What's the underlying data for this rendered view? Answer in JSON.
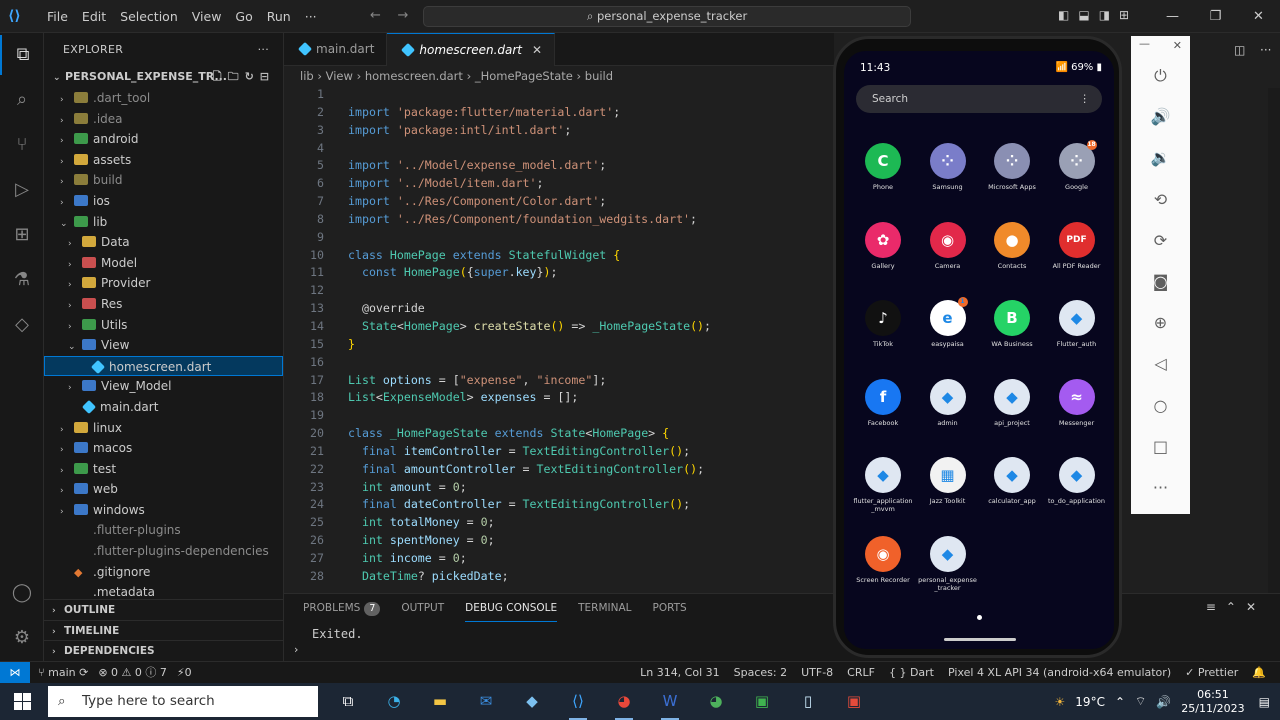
{
  "window": {
    "menu": [
      "File",
      "Edit",
      "Selection",
      "View",
      "Go",
      "Run",
      "···"
    ],
    "command_center": "personal_expense_tracker",
    "controls": [
      "—",
      "❐",
      "✕"
    ]
  },
  "activity_bar": [
    "explorer-icon",
    "search-icon",
    "source-control-icon",
    "run-debug-icon",
    "extensions-icon",
    "testing-icon",
    "flutter-icon",
    "account-icon",
    "settings-gear-icon"
  ],
  "explorer": {
    "title": "EXPLORER",
    "project": "PERSONAL_EXPENSE_TR...",
    "items": [
      {
        "label": ".dart_tool",
        "indent": 1,
        "kind": "folder",
        "dim": true
      },
      {
        "label": ".idea",
        "indent": 1,
        "kind": "folder",
        "dim": true
      },
      {
        "label": "android",
        "indent": 1,
        "kind": "folder-green"
      },
      {
        "label": "assets",
        "indent": 1,
        "kind": "folder-yellow"
      },
      {
        "label": "build",
        "indent": 1,
        "kind": "folder",
        "dim": true
      },
      {
        "label": "ios",
        "indent": 1,
        "kind": "folder-blue"
      },
      {
        "label": "lib",
        "indent": 1,
        "kind": "folder-green",
        "open": true
      },
      {
        "label": "Data",
        "indent": 2,
        "kind": "folder-yellow"
      },
      {
        "label": "Model",
        "indent": 2,
        "kind": "folder-red"
      },
      {
        "label": "Provider",
        "indent": 2,
        "kind": "folder-yellow"
      },
      {
        "label": "Res",
        "indent": 2,
        "kind": "folder-red"
      },
      {
        "label": "Utils",
        "indent": 2,
        "kind": "folder-green"
      },
      {
        "label": "View",
        "indent": 2,
        "kind": "folder-blue",
        "open": true
      },
      {
        "label": "homescreen.dart",
        "indent": 3,
        "kind": "dart",
        "selected": true
      },
      {
        "label": "View_Model",
        "indent": 2,
        "kind": "folder-blue"
      },
      {
        "label": "main.dart",
        "indent": 2,
        "kind": "dart"
      },
      {
        "label": "linux",
        "indent": 1,
        "kind": "folder-yellow"
      },
      {
        "label": "macos",
        "indent": 1,
        "kind": "folder-blue"
      },
      {
        "label": "test",
        "indent": 1,
        "kind": "folder-green"
      },
      {
        "label": "web",
        "indent": 1,
        "kind": "folder-blue"
      },
      {
        "label": "windows",
        "indent": 1,
        "kind": "folder-blue"
      },
      {
        "label": ".flutter-plugins",
        "indent": 1,
        "kind": "file",
        "dim": true
      },
      {
        "label": ".flutter-plugins-dependencies",
        "indent": 1,
        "kind": "file",
        "dim": true
      },
      {
        "label": ".gitignore",
        "indent": 1,
        "kind": "git"
      },
      {
        "label": ".metadata",
        "indent": 1,
        "kind": "file"
      }
    ],
    "sections": [
      "OUTLINE",
      "TIMELINE",
      "DEPENDENCIES"
    ]
  },
  "editor": {
    "tabs": [
      {
        "label": "main.dart",
        "active": false
      },
      {
        "label": "homescreen.dart",
        "active": true
      }
    ],
    "breadcrumb": [
      "lib",
      "View",
      "homescreen.dart",
      "_HomePageState",
      "build"
    ],
    "lines": [
      [],
      [
        [
          "k",
          "import "
        ],
        [
          "s",
          "'package:flutter/material.dart'"
        ],
        [
          "p",
          ";"
        ]
      ],
      [
        [
          "k",
          "import "
        ],
        [
          "s",
          "'package:intl/intl.dart'"
        ],
        [
          "p",
          ";"
        ]
      ],
      [],
      [
        [
          "k",
          "import "
        ],
        [
          "s",
          "'../Model/expense_model.dart'"
        ],
        [
          "p",
          ";"
        ]
      ],
      [
        [
          "k",
          "import "
        ],
        [
          "s",
          "'../Model/item.dart'"
        ],
        [
          "p",
          ";"
        ]
      ],
      [
        [
          "k",
          "import "
        ],
        [
          "s",
          "'../Res/Component/Color.dart'"
        ],
        [
          "p",
          ";"
        ]
      ],
      [
        [
          "k",
          "import "
        ],
        [
          "s",
          "'../Res/Component/foundation_wedgits.dart'"
        ],
        [
          "p",
          ";"
        ]
      ],
      [],
      [
        [
          "k",
          "class "
        ],
        [
          "t",
          "HomePage "
        ],
        [
          "k",
          "extends "
        ],
        [
          "t",
          "StatefulWidget "
        ],
        [
          "y",
          "{"
        ]
      ],
      [
        [
          "p",
          "  "
        ],
        [
          "k",
          "const "
        ],
        [
          "t",
          "HomePage"
        ],
        [
          "y",
          "("
        ],
        [
          "p",
          "{"
        ],
        [
          "k",
          "super"
        ],
        [
          "p",
          "."
        ],
        [
          "v",
          "key"
        ],
        [
          "p",
          "}"
        ],
        [
          "y",
          ")"
        ],
        [
          "p",
          ";"
        ]
      ],
      [],
      [
        [
          "p",
          "  @override"
        ]
      ],
      [
        [
          "p",
          "  "
        ],
        [
          "t",
          "State"
        ],
        [
          "p",
          "<"
        ],
        [
          "t",
          "HomePage"
        ],
        [
          "p",
          "> "
        ],
        [
          "f",
          "createState"
        ],
        [
          "y",
          "()"
        ],
        [
          "p",
          " => "
        ],
        [
          "t",
          "_HomePageState"
        ],
        [
          "y",
          "()"
        ],
        [
          "p",
          ";"
        ]
      ],
      [
        [
          "y",
          "}"
        ]
      ],
      [],
      [
        [
          "t",
          "List "
        ],
        [
          "v",
          "options"
        ],
        [
          "p",
          " = ["
        ],
        [
          "s",
          "\"expense\""
        ],
        [
          "p",
          ", "
        ],
        [
          "s",
          "\"income\""
        ],
        [
          "p",
          "];"
        ]
      ],
      [
        [
          "t",
          "List"
        ],
        [
          "p",
          "<"
        ],
        [
          "t",
          "ExpenseModel"
        ],
        [
          "p",
          "> "
        ],
        [
          "v",
          "expenses"
        ],
        [
          "p",
          " = [];"
        ]
      ],
      [],
      [
        [
          "k",
          "class "
        ],
        [
          "t",
          "_HomePageState "
        ],
        [
          "k",
          "extends "
        ],
        [
          "t",
          "State"
        ],
        [
          "p",
          "<"
        ],
        [
          "t",
          "HomePage"
        ],
        [
          "p",
          "> "
        ],
        [
          "y",
          "{"
        ]
      ],
      [
        [
          "p",
          "  "
        ],
        [
          "k",
          "final "
        ],
        [
          "v",
          "itemController"
        ],
        [
          "p",
          " = "
        ],
        [
          "t",
          "TextEditingController"
        ],
        [
          "y",
          "()"
        ],
        [
          "p",
          ";"
        ]
      ],
      [
        [
          "p",
          "  "
        ],
        [
          "k",
          "final "
        ],
        [
          "v",
          "amountController"
        ],
        [
          "p",
          " = "
        ],
        [
          "t",
          "TextEditingController"
        ],
        [
          "y",
          "()"
        ],
        [
          "p",
          ";"
        ]
      ],
      [
        [
          "p",
          "  "
        ],
        [
          "t",
          "int "
        ],
        [
          "v",
          "amount"
        ],
        [
          "p",
          " = "
        ],
        [
          "n",
          "0"
        ],
        [
          "p",
          ";"
        ]
      ],
      [
        [
          "p",
          "  "
        ],
        [
          "k",
          "final "
        ],
        [
          "v",
          "dateController"
        ],
        [
          "p",
          " = "
        ],
        [
          "t",
          "TextEditingController"
        ],
        [
          "y",
          "()"
        ],
        [
          "p",
          ";"
        ]
      ],
      [
        [
          "p",
          "  "
        ],
        [
          "t",
          "int "
        ],
        [
          "v",
          "totalMoney"
        ],
        [
          "p",
          " = "
        ],
        [
          "n",
          "0"
        ],
        [
          "p",
          ";"
        ]
      ],
      [
        [
          "p",
          "  "
        ],
        [
          "t",
          "int "
        ],
        [
          "v",
          "spentMoney"
        ],
        [
          "p",
          " = "
        ],
        [
          "n",
          "0"
        ],
        [
          "p",
          ";"
        ]
      ],
      [
        [
          "p",
          "  "
        ],
        [
          "t",
          "int "
        ],
        [
          "v",
          "income"
        ],
        [
          "p",
          " = "
        ],
        [
          "n",
          "0"
        ],
        [
          "p",
          ";"
        ]
      ],
      [
        [
          "p",
          "  "
        ],
        [
          "t",
          "DateTime"
        ],
        [
          "p",
          "? "
        ],
        [
          "v",
          "pickedDate"
        ],
        [
          "p",
          ";"
        ]
      ]
    ]
  },
  "panel": {
    "tabs": [
      {
        "label": "PROBLEMS",
        "badge": "7"
      },
      {
        "label": "OUTPUT"
      },
      {
        "label": "DEBUG CONSOLE",
        "active": true
      },
      {
        "label": "TERMINAL"
      },
      {
        "label": "PORTS"
      }
    ],
    "console_text": "Exited.",
    "prompt": "›"
  },
  "statusbar": {
    "branch": "main",
    "sync": "⟳",
    "errors": "⊗ 0 ⚠ 0 ⓘ 7",
    "ports": "⚡0",
    "position": "Ln 314, Col 31",
    "spaces": "Spaces: 2",
    "encoding": "UTF-8",
    "eol": "CRLF",
    "language": "{ } Dart",
    "device": "Pixel 4 XL API 34 (android-x64 emulator)",
    "prettier": "✓ Prettier"
  },
  "phone": {
    "time": "11:43",
    "status_right": "📶 69% ▮",
    "search_placeholder": "Search",
    "apps": [
      {
        "label": "Phone",
        "color": "#1db954",
        "glyph": "C",
        "col": 0,
        "row": 0
      },
      {
        "label": "Samsung",
        "color": "#7a7dc9",
        "glyph": "⁘",
        "col": 1,
        "row": 0
      },
      {
        "label": "Microsoft Apps",
        "color": "#8a8fb3",
        "glyph": "⁘",
        "col": 2,
        "row": 0
      },
      {
        "label": "Google",
        "color": "#9aa0b5",
        "glyph": "⁘",
        "col": 3,
        "row": 0,
        "badge": "18"
      },
      {
        "label": "Gallery",
        "color": "#ea2a6a",
        "glyph": "✿",
        "col": 0,
        "row": 1
      },
      {
        "label": "Camera",
        "color": "#e2284a",
        "glyph": "◉",
        "col": 1,
        "row": 1
      },
      {
        "label": "Contacts",
        "color": "#f08a2a",
        "glyph": "●",
        "col": 2,
        "row": 1
      },
      {
        "label": "All PDF Reader",
        "color": "#e02e2e",
        "glyph": "PDF",
        "col": 3,
        "row": 1
      },
      {
        "label": "TikTok",
        "color": "#111111",
        "glyph": "♪",
        "col": 0,
        "row": 2
      },
      {
        "label": "easypaisa",
        "color": "#ffffff",
        "glyph": "e",
        "col": 1,
        "row": 2,
        "badge": "1"
      },
      {
        "label": "WA Business",
        "color": "#25d366",
        "glyph": "B",
        "col": 2,
        "row": 2
      },
      {
        "label": "Flutter_auth",
        "color": "#dfe7f2",
        "glyph": "◆",
        "col": 3,
        "row": 2
      },
      {
        "label": "Facebook",
        "color": "#1877f2",
        "glyph": "f",
        "col": 0,
        "row": 3
      },
      {
        "label": "admin",
        "color": "#dfe7f2",
        "glyph": "◆",
        "col": 1,
        "row": 3
      },
      {
        "label": "api_project",
        "color": "#dfe7f2",
        "glyph": "◆",
        "col": 2,
        "row": 3
      },
      {
        "label": "Messenger",
        "color": "#a45bf0",
        "glyph": "≈",
        "col": 3,
        "row": 3
      },
      {
        "label": "flutter_application _mvvm",
        "color": "#dfe7f2",
        "glyph": "◆",
        "col": 0,
        "row": 4
      },
      {
        "label": "Jazz Toolkit",
        "color": "#f2f2f2",
        "glyph": "▦",
        "col": 1,
        "row": 4
      },
      {
        "label": "calculator_app",
        "color": "#dfe7f2",
        "glyph": "◆",
        "col": 2,
        "row": 4
      },
      {
        "label": "to_do_application",
        "color": "#dfe7f2",
        "glyph": "◆",
        "col": 3,
        "row": 4
      },
      {
        "label": "Screen Recorder",
        "color": "#f0612a",
        "glyph": "◉",
        "col": 0,
        "row": 5
      },
      {
        "label": "personal_expense _tracker",
        "color": "#dfe7f2",
        "glyph": "◆",
        "col": 1,
        "row": 5
      }
    ]
  },
  "emulator_tools": [
    "power-icon",
    "volume-up-icon",
    "volume-down-icon",
    "rotate-left-icon",
    "rotate-right-icon",
    "camera-icon",
    "zoom-icon",
    "back-icon",
    "home-icon",
    "overview-icon",
    "more-icon"
  ],
  "taskbar": {
    "search_placeholder": "Type here to search",
    "weather": "19°C",
    "time": "06:51",
    "date": "25/11/2023"
  }
}
